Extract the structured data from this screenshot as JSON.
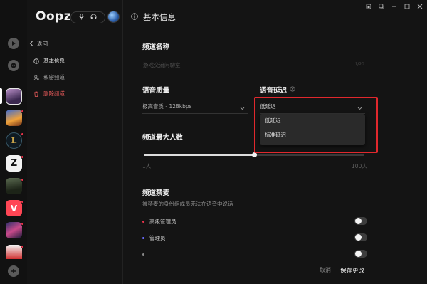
{
  "app": {
    "logo_text": "Oopz"
  },
  "nav": {
    "back_label": "返回",
    "items": [
      {
        "label": "基本信息",
        "icon": "info-icon",
        "active": true
      },
      {
        "label": "私密频道",
        "icon": "user-lock-icon",
        "active": false
      },
      {
        "label": "删除频道",
        "icon": "trash-icon",
        "danger": true
      }
    ]
  },
  "page": {
    "title": "基本信息"
  },
  "channel_name": {
    "label": "频道名称",
    "placeholder": "游戏交流闲聊室",
    "counter": "?/20"
  },
  "voice_quality": {
    "label": "语音质量",
    "value": "极高音质 - 128kbps"
  },
  "voice_latency": {
    "label": "语音延迟",
    "value": "低延迟",
    "options": [
      "低延迟",
      "标准延迟"
    ]
  },
  "max_members": {
    "label": "频道最大人数",
    "min_label": "1人",
    "max_label": "100人",
    "value_fraction": 0.5
  },
  "mute": {
    "label": "频道禁麦",
    "hint": "被禁麦的身份组成员无法在语音中说话",
    "roles": [
      {
        "label": "高级管理员",
        "color": "#e8334a",
        "on": false
      },
      {
        "label": "管理员",
        "color": "#6a6cff",
        "on": false
      },
      {
        "label": "",
        "color": "#888888",
        "on": false
      }
    ]
  },
  "footer": {
    "cancel_label": "取消",
    "save_label": "保存更改"
  },
  "colors": {
    "accent_red": "#e0282d",
    "background": "#141414"
  }
}
